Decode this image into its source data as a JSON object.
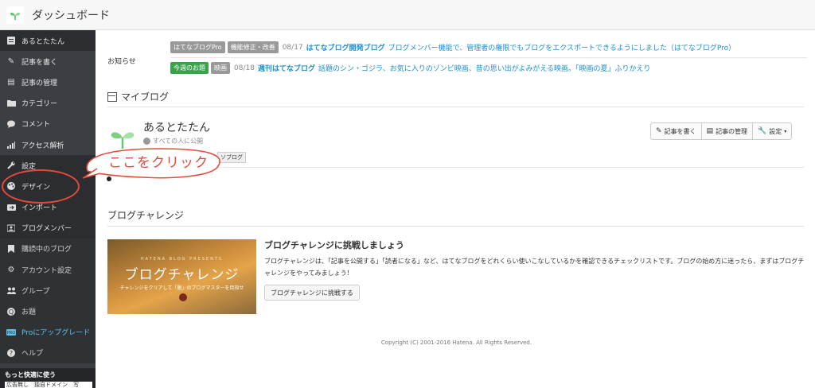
{
  "header": {
    "title": "ダッシュボード"
  },
  "sidebar": {
    "items": [
      {
        "label": "あるとたたん",
        "icon": "blog-icon"
      },
      {
        "label": "記事を書く",
        "icon": "edit-icon"
      },
      {
        "label": "記事の管理",
        "icon": "document-icon"
      },
      {
        "label": "カテゴリー",
        "icon": "folder-icon"
      },
      {
        "label": "コメント",
        "icon": "comment-icon"
      },
      {
        "label": "アクセス解析",
        "icon": "chart-icon"
      },
      {
        "label": "設定",
        "icon": "wrench-icon"
      },
      {
        "label": "デザイン",
        "icon": "palette-icon"
      },
      {
        "label": "インポート",
        "icon": "import-icon"
      },
      {
        "label": "ブログメンバー",
        "icon": "members-icon"
      },
      {
        "label": "購読中のブログ",
        "icon": "bookmark-icon"
      },
      {
        "label": "アカウント設定",
        "icon": "gear-icon"
      },
      {
        "label": "グループ",
        "icon": "group-icon"
      },
      {
        "label": "お題",
        "icon": "question-icon"
      },
      {
        "label": "Proにアップグレード",
        "icon": "pro-icon"
      },
      {
        "label": "ヘルプ",
        "icon": "help-icon"
      }
    ],
    "footer": {
      "title": "もっと快適に使う",
      "text": "広告無し　独自ドメイン　写"
    }
  },
  "notices": {
    "label": "お知らせ",
    "rows": [
      {
        "tags": [
          "はてなブログPro",
          "機能修正・改善"
        ],
        "date": "08/17",
        "title": "はてなブログ開発ブログ",
        "text": "ブログメンバー機能で、管理者の権限でもブログをエクスポートできるようにしました（はてなブログPro）"
      },
      {
        "tags": [
          "今週のお題",
          "映画"
        ],
        "date": "08/18",
        "title": "週刊はてなブログ",
        "text": "話題のシン・ゴジラ、お気に入りのゾンビ映画、昔の思い出がよみがえる映画。「映画の夏」ふりかえり"
      }
    ]
  },
  "myblog": {
    "title": "マイブログ",
    "blog_name": "あるとたたん",
    "visibility": "すべての人に公開",
    "tag": "ソブログ",
    "buttons": {
      "write": "記事を書く",
      "manage": "記事の管理",
      "settings": "設定"
    }
  },
  "callout": {
    "text": "ここをクリック"
  },
  "challenge": {
    "section_title": "ブログチャレンジ",
    "image": {
      "small": "HATENA BLOG PRESENTS",
      "big": "ブログチャレンジ",
      "sub": "チャレンジをクリアして「脱」のブログマスターを目指せ"
    },
    "heading": "ブログチャレンジに挑戦しましょう",
    "desc": "ブログチャレンジは、「記事を公開する」「読者になる」など、はてなブログをどれくらい使いこなしているかを確認できるチェックリストです。ブログの始め方に迷ったら、まずはブログチャレンジをやってみましょう！",
    "button": "ブログチャレンジに挑戦する"
  },
  "footer": {
    "copyright": "Copyright (C) 2001-2016 Hatena. All Rights Reserved."
  },
  "colors": {
    "sidebar_bg": "#3b3e42",
    "link": "#1c8fd0",
    "callout": "#e24b3b",
    "pro": "#5cc3e6",
    "tag_green": "#3aa24a"
  }
}
